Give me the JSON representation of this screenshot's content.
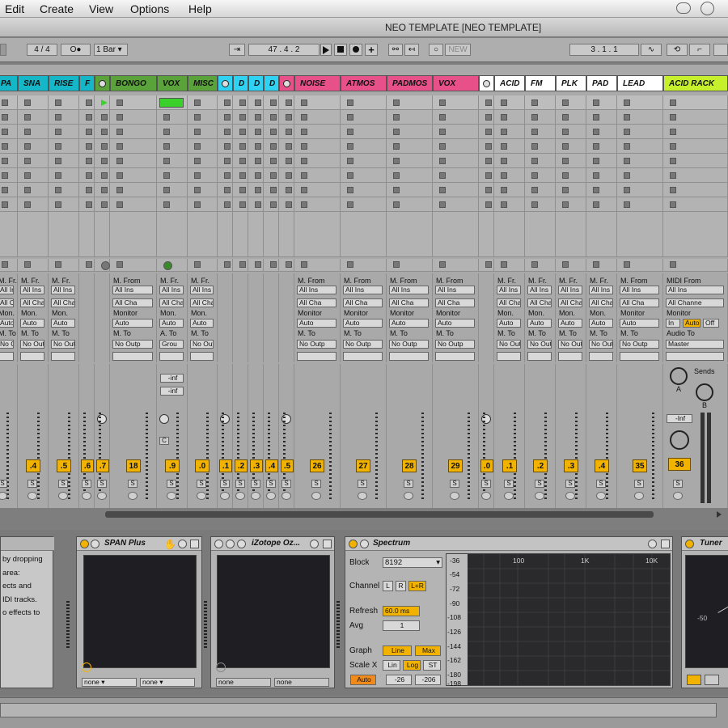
{
  "menu": [
    "Edit",
    "Create",
    "View",
    "Options",
    "Help"
  ],
  "window_title": "NEO TEMPLATE  [NEO TEMPLATE]",
  "toolbar": {
    "signature": "4 / 4",
    "metronome": "O●",
    "quantize": "1 Bar",
    "follow": "⇥",
    "position": "47 .   4 .   2",
    "new": "NEW",
    "loop_start": "3 .   1 .   1"
  },
  "tracks": [
    {
      "name": "PA",
      "color": "#15b6c8",
      "num": "",
      "ch": "MFr"
    },
    {
      "name": "SNA",
      "color": "#15b6c8",
      "num": ".4",
      "ch": "MFr"
    },
    {
      "name": "RISE",
      "color": "#15b6c8",
      "num": ".5",
      "ch": "MFr"
    },
    {
      "name": "F",
      "color": "#15b6c8",
      "num": ".6",
      "ch": "none"
    },
    {
      "name": "",
      "color": "#5aa23a",
      "num": ".7",
      "ch": "none"
    },
    {
      "name": "BONGO",
      "color": "#5aa23a",
      "num": "18",
      "ch": "MFrom"
    },
    {
      "name": "VOX",
      "color": "#5aa23a",
      "num": ".9",
      "ch": "MFr"
    },
    {
      "name": "MISC",
      "color": "#5aa23a",
      "num": ".0",
      "ch": "MFr"
    },
    {
      "name": "",
      "color": "#2fd2f2",
      "num": ".1",
      "ch": "none"
    },
    {
      "name": "D",
      "color": "#2fd2f2",
      "num": ".2",
      "ch": "none"
    },
    {
      "name": "D",
      "color": "#2fd2f2",
      "num": ".3",
      "ch": "none"
    },
    {
      "name": "D",
      "color": "#2fd2f2",
      "num": ".4",
      "ch": "none"
    },
    {
      "name": "",
      "color": "#e8508a",
      "num": ".5",
      "ch": "none"
    },
    {
      "name": "NOISE",
      "color": "#e8508a",
      "num": "26",
      "ch": "MFrom"
    },
    {
      "name": "ATMOS",
      "color": "#e8508a",
      "num": "27",
      "ch": "MFrom"
    },
    {
      "name": "PADMOS",
      "color": "#e8508a",
      "num": "28",
      "ch": "MFrom"
    },
    {
      "name": "VOX",
      "color": "#e8508a",
      "num": "29",
      "ch": "MFrom"
    },
    {
      "name": "",
      "color": "#ffffff",
      "num": ".0",
      "ch": "none"
    },
    {
      "name": "ACID",
      "color": "#ffffff",
      "num": ".1",
      "ch": "MFr"
    },
    {
      "name": "FM",
      "color": "#ffffff",
      "num": ".2",
      "ch": "MFr"
    },
    {
      "name": "PLK",
      "color": "#ffffff",
      "num": ".3",
      "ch": "MFr"
    },
    {
      "name": "PAD",
      "color": "#ffffff",
      "num": ".4",
      "ch": "MFr"
    },
    {
      "name": "LEAD",
      "color": "#ffffff",
      "num": "35",
      "ch": "MFrom"
    },
    {
      "name": "ACID RACK",
      "color": "#c7f02c",
      "num": "36",
      "ch": "MIDI"
    }
  ],
  "io": {
    "mfr": "M. Fr.",
    "mfrom": "M. From",
    "midi_from": "MIDI From",
    "all_ins": "All Ins",
    "all_ch": "All Cha",
    "all_channels": "All Channe",
    "mon": "Mon.",
    "monitor": "Monitor",
    "auto": "Auto",
    "mto": "M. To",
    "ato": "A. To",
    "audio_to": "Audio To",
    "no_out": "No Outp",
    "master": "Master",
    "group": "Grou",
    "in": "In",
    "off": "Off"
  },
  "vox_inf": [
    "-inf",
    "-inf"
  ],
  "rack": {
    "sends": "Sends",
    "a": "A",
    "b": "B",
    "inf": "-Inf"
  },
  "solo_label": "S",
  "browser_text": [
    "by dropping",
    "area:",
    "ects and",
    "IDI tracks.",
    "o effects to"
  ],
  "devices": {
    "span": {
      "title": "SPAN Plus",
      "sel1": "none",
      "sel2": "none"
    },
    "ozone": {
      "title": "iZotope Oz...",
      "sel1": "none",
      "sel2": "none"
    },
    "spectrum": {
      "title": "Spectrum",
      "block_label": "Block",
      "block": "8192",
      "channel_label": "Channel",
      "ch_l": "L",
      "ch_r": "R",
      "ch_lr": "L+R",
      "refresh_label": "Refresh",
      "refresh": "60.0 ms",
      "avg_label": "Avg",
      "avg": "1",
      "graph_label": "Graph",
      "line": "Line",
      "max": "Max",
      "scalex_label": "Scale X",
      "lin": "Lin",
      "log": "Log",
      "st": "ST",
      "auto": "Auto",
      "range_lo": "-26",
      "range_hi": "-206",
      "db": [
        "-36",
        "-54",
        "-72",
        "-90",
        "-108",
        "-126",
        "-144",
        "-162",
        "-180",
        "-198"
      ],
      "freq": [
        "100",
        "1K",
        "10K"
      ]
    },
    "tuner": {
      "title": "Tuner",
      "mark": "-50"
    }
  }
}
